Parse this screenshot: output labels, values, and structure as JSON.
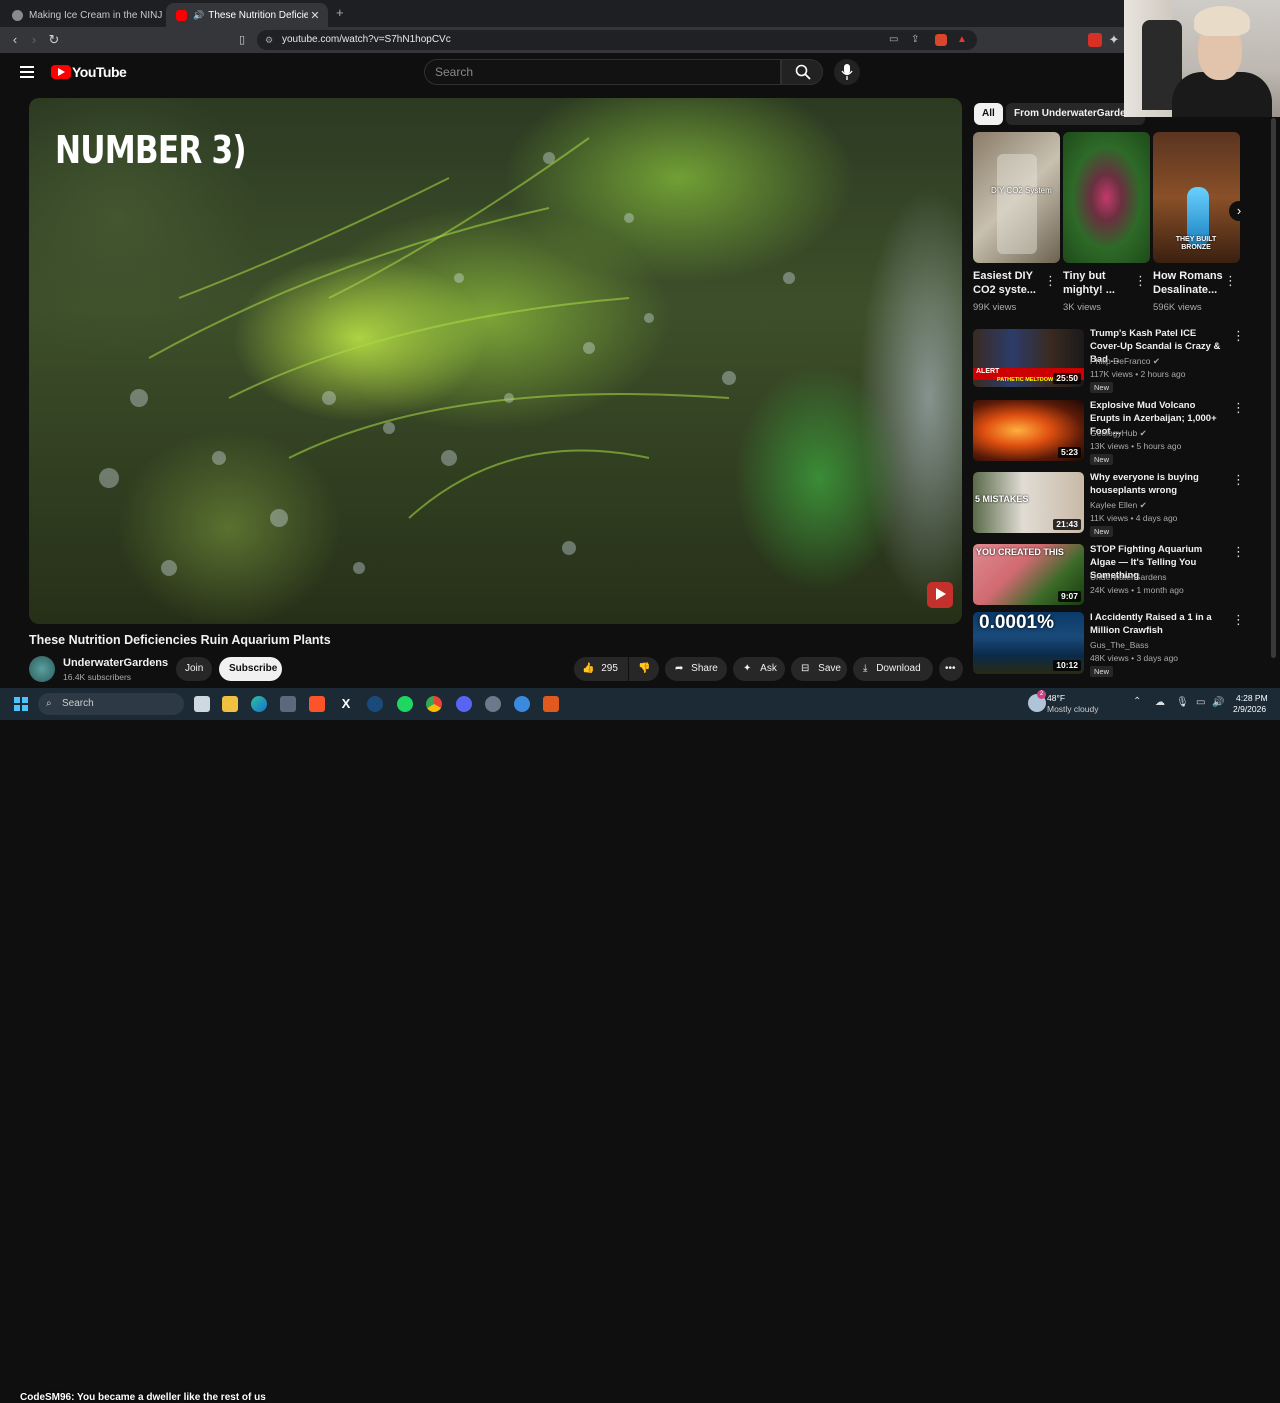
{
  "browser": {
    "tabs": [
      {
        "title": "Making Ice Cream in the NINJA CREAMi"
      },
      {
        "title": "These Nutrition Deficiencies Ruin Aquarium Plants"
      }
    ],
    "new_tab": "+",
    "url": "youtube.com/watch?v=S7hN1hopCVc"
  },
  "youtube": {
    "logo_text": "YouTube",
    "search_placeholder": "Search"
  },
  "player": {
    "overlay_text": "NUMBER 3)"
  },
  "video": {
    "title": "These Nutrition Deficiencies Ruin Aquarium Plants",
    "channel": "UnderwaterGardens",
    "subscribers": "16.4K subscribers",
    "join": "Join",
    "subscribe": "Subscribe",
    "likes": "295",
    "share": "Share",
    "ask": "Ask",
    "save": "Save",
    "download": "Download"
  },
  "chips": [
    "All",
    "From UnderwaterGardens"
  ],
  "shorts": [
    {
      "title": "Easiest DIY CO2 syste...",
      "views": "99K views",
      "thumb_text": "DIY CO2 System"
    },
    {
      "title": "Tiny but mighty! ...",
      "views": "3K views",
      "thumb_text": ""
    },
    {
      "title": "How Romans Desalinate...",
      "views": "596K views",
      "thumb_text": "THEY BUILT BRONZE"
    }
  ],
  "recommended": [
    {
      "title": "Trump's Kash Patel ICE Cover-Up Scandal is Crazy & Bad ...",
      "channel": "Philip DeFranco",
      "meta": "117K views • 2 hours ago",
      "duration": "25:50",
      "badge": "New",
      "thumb_text": "ALERT",
      "thumb_text2": "PATHETIC MELTDOWN"
    },
    {
      "title": "Explosive Mud Volcano Erupts in Azerbaijan; 1,000+ Foot ...",
      "channel": "GeologyHub",
      "meta": "13K views • 5 hours ago",
      "duration": "5:23",
      "badge": "New",
      "thumb_text": "",
      "thumb_text2": ""
    },
    {
      "title": "Why everyone is buying houseplants wrong",
      "channel": "Kaylee Ellen",
      "meta": "11K views • 4 days ago",
      "duration": "21:43",
      "badge": "New",
      "thumb_text": "5 MISTAKES",
      "thumb_text2": ""
    },
    {
      "title": "STOP Fighting Aquarium Algae — It's Telling You Something",
      "channel": "UnderwaterGardens",
      "meta": "24K views • 1 month ago",
      "duration": "9:07",
      "badge": "",
      "thumb_text": "YOU CREATED THIS",
      "thumb_text2": ""
    },
    {
      "title": "I Accidently Raised a 1 in a Million Crawfish",
      "channel": "Gus_The_Bass",
      "meta": "48K views • 3 days ago",
      "duration": "10:12",
      "badge": "New",
      "thumb_text": "0.0001%",
      "thumb_text2": ""
    }
  ],
  "taskbar": {
    "search": "Search",
    "chat": "CodeSM96: You became a dweller like the rest of us",
    "weather_temp": "48°F",
    "weather_desc": "Mostly cloudy",
    "time": "4:28 PM",
    "date": "2/9/2026",
    "badge_count": "2"
  },
  "colors": {
    "youtube_red": "#ff0000",
    "bg": "#0f0f0f",
    "taskbar": "#1c2a36"
  }
}
